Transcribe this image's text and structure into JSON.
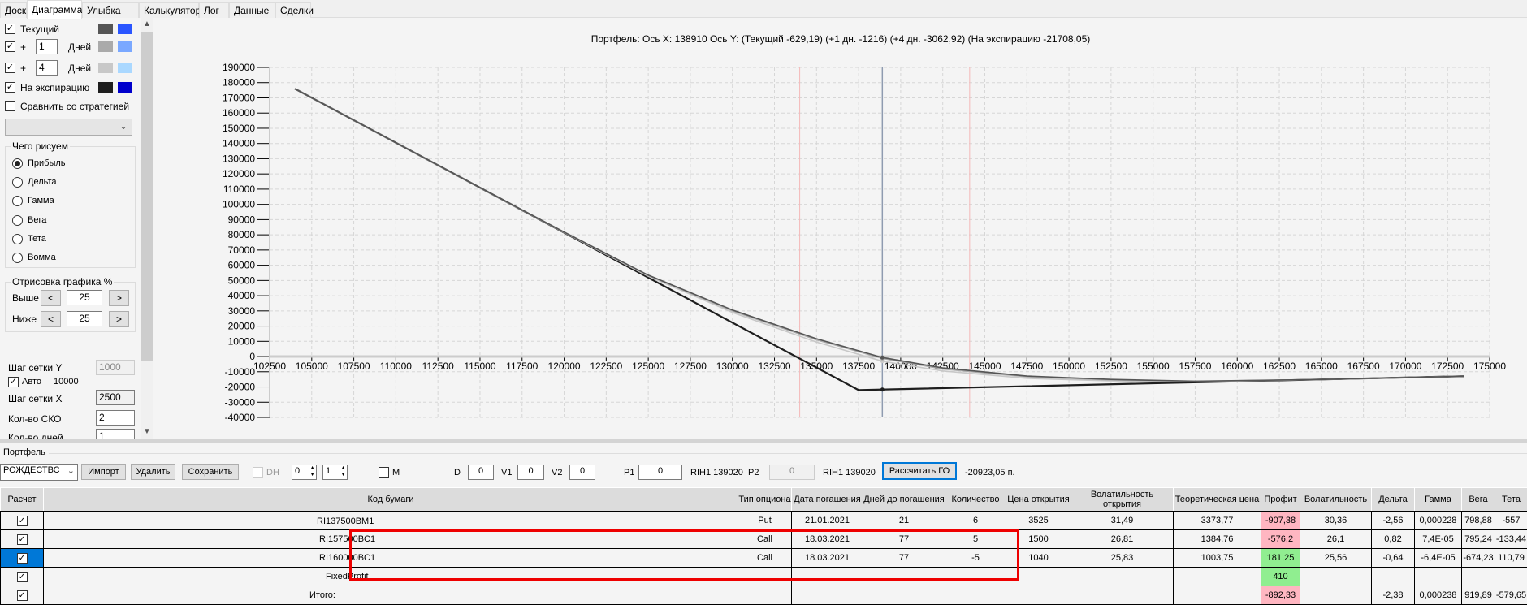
{
  "tabs": [
    {
      "label": "Доска"
    },
    {
      "label": "Диаграмма",
      "active": true
    },
    {
      "label": "Улыбка"
    },
    {
      "label": "Калькулятор"
    },
    {
      "label": "Лог"
    },
    {
      "label": "Данные"
    },
    {
      "label": "Сделки"
    }
  ],
  "left_panel": {
    "series_toggles": [
      {
        "label": "Текущий",
        "checked": true,
        "color1": "#555555",
        "color2": "#2a55ff"
      },
      {
        "prefix": "+",
        "days": "1",
        "suffix": "Дней",
        "checked": true,
        "color1": "#aaaaaa",
        "color2": "#7aa8ff"
      },
      {
        "prefix": "+",
        "days": "4",
        "suffix": "Дней",
        "checked": true,
        "color1": "#c8c8c8",
        "color2": "#aad8ff"
      },
      {
        "label": "На экспирацию",
        "checked": true,
        "color1": "#1e1e1e",
        "color2": "#0000cc"
      }
    ],
    "compare_label": "Сравнить со стратегией",
    "compare_checked": false,
    "compare_select": "",
    "draw_group": {
      "title": "Чего рисуем",
      "options": [
        "Прибыль",
        "Дельта",
        "Гамма",
        "Вега",
        "Тета",
        "Вомма"
      ],
      "selected": "Прибыль"
    },
    "render_group": {
      "title": "Отрисовка графика %",
      "above_label": "Выше",
      "above_value": "25",
      "below_label": "Ниже",
      "below_value": "25",
      "dec": "<",
      "inc": ">"
    },
    "grid_y_label": "Шаг сетки Y",
    "grid_y_value": "1000",
    "auto_label": "Авто",
    "auto_checked": true,
    "auto_value": "10000",
    "grid_x_label": "Шаг сетки X",
    "grid_x_value": "2500",
    "sko_label": "Кол-во СКО",
    "sko_value": "2",
    "days_label": "Кол-во дней",
    "days_value": "1"
  },
  "chart_data": {
    "type": "line",
    "title": "Портфель: Ось X: 138910 Ось Y:  (Текущий -629,19)  (+1 дн. -1216)  (+4 дн. -3062,92)  (На экспирацию -21708,05)",
    "xlim": [
      102500,
      175000
    ],
    "ylim": [
      -40000,
      190000
    ],
    "x_ticks": [
      102500,
      105000,
      107500,
      110000,
      112500,
      115000,
      117500,
      120000,
      122500,
      125000,
      127500,
      130000,
      132500,
      135000,
      137500,
      140000,
      142500,
      145000,
      147500,
      150000,
      152500,
      155000,
      157500,
      160000,
      162500,
      165000,
      167500,
      170000,
      172500,
      175000
    ],
    "y_ticks": [
      190000,
      180000,
      170000,
      160000,
      150000,
      140000,
      130000,
      120000,
      110000,
      100000,
      90000,
      80000,
      70000,
      60000,
      50000,
      40000,
      30000,
      20000,
      10000,
      0,
      -10000,
      -20000,
      -30000,
      -40000
    ],
    "grid": true,
    "cursor_x": 138910,
    "sd_lines": [
      134000,
      144100
    ],
    "series": [
      {
        "name": "На экспирацию",
        "color": "#1e1e1e",
        "points": [
          [
            104000,
            176000
          ],
          [
            137500,
            -22050
          ],
          [
            173500,
            -12900
          ]
        ]
      },
      {
        "name": "+4 дн.",
        "color": "#c8c8c8",
        "points": [
          [
            104000,
            176000
          ],
          [
            110000,
            140500
          ],
          [
            115000,
            110900
          ],
          [
            120000,
            81500
          ],
          [
            125000,
            52800
          ],
          [
            130000,
            29000
          ],
          [
            135000,
            9500
          ],
          [
            138910,
            -3063
          ],
          [
            142500,
            -9500
          ],
          [
            147500,
            -14300
          ],
          [
            152500,
            -16000
          ],
          [
            157500,
            -16600
          ],
          [
            165000,
            -15060
          ],
          [
            173500,
            -12900
          ]
        ]
      },
      {
        "name": "+1 дн.",
        "color": "#aaaaaa",
        "points": [
          [
            104000,
            176000
          ],
          [
            110000,
            140500
          ],
          [
            115000,
            111000
          ],
          [
            120000,
            81700
          ],
          [
            125000,
            53300
          ],
          [
            130000,
            30000
          ],
          [
            135000,
            11000
          ],
          [
            138910,
            -1216
          ],
          [
            142500,
            -8200
          ],
          [
            147500,
            -13300
          ],
          [
            152500,
            -15400
          ],
          [
            157500,
            -16300
          ],
          [
            165000,
            -15060
          ],
          [
            173500,
            -12900
          ]
        ]
      },
      {
        "name": "Текущий",
        "color": "#555555",
        "points": [
          [
            104000,
            176000
          ],
          [
            110000,
            140500
          ],
          [
            115000,
            111000
          ],
          [
            120000,
            81800
          ],
          [
            125000,
            53500
          ],
          [
            130000,
            30600
          ],
          [
            135000,
            11700
          ],
          [
            138910,
            -629
          ],
          [
            142500,
            -7500
          ],
          [
            147500,
            -12800
          ],
          [
            152500,
            -15000
          ],
          [
            157500,
            -16200
          ],
          [
            165000,
            -15060
          ],
          [
            173500,
            -12900
          ]
        ]
      }
    ]
  },
  "portfolio": {
    "title": "Портфель",
    "name_select": "РОЖДЕСТВС",
    "import": "Импорт",
    "delete": "Удалить",
    "save": "Сохранить",
    "dh_label": "DH",
    "spin1": "0",
    "spin2": "1",
    "m_label": "M",
    "d_label": "D",
    "d_value": "0",
    "v1_label": "V1",
    "v1_value": "0",
    "v2_label": "V2",
    "v2_value": "0",
    "p1_label": "P1",
    "p1_value": "0",
    "p1_ref": "RIH1 139020",
    "p2_label": "P2",
    "p2_value": "0",
    "p2_ref": "RIH1 139020",
    "calc_go": "Рассчитать ГО",
    "go_value": "-20923,05 п."
  },
  "table": {
    "headers": [
      "Расчет",
      "Код бумаги",
      "Тип опциона",
      "Дата погашения",
      "Дней до погашения",
      "Количество",
      "Цена открытия",
      "Волатильность открытия",
      "Теоретическая цена",
      "Профит",
      "Волатильность",
      "Дельта",
      "Гамма",
      "Вега",
      "Тета"
    ],
    "rows": [
      {
        "cells": [
          "RI137500BM1",
          "Put",
          "21.01.2021",
          "21",
          "6",
          "3525",
          "31,49",
          "3373,77",
          "-907,38",
          "30,36",
          "-2,56",
          "0,000228",
          "798,88",
          "-557"
        ],
        "profit_state": "neg"
      },
      {
        "cells": [
          "RI157500BC1",
          "Call",
          "18.03.2021",
          "77",
          "5",
          "1500",
          "26,81",
          "1384,76",
          "-576,2",
          "26,1",
          "0,82",
          "7,4E-05",
          "795,24",
          "-133,44"
        ],
        "profit_state": "neg"
      },
      {
        "cells": [
          "RI160000BC1",
          "Call",
          "18.03.2021",
          "77",
          "-5",
          "1040",
          "25,83",
          "1003,75",
          "181,25",
          "25,56",
          "-0,64",
          "-6,4E-05",
          "-674,23",
          "110,79"
        ],
        "profit_state": "pos",
        "selected": true
      },
      {
        "cells": [
          "FixedProfit",
          "",
          "",
          "",
          "",
          "",
          "",
          "",
          "410",
          "",
          "",
          "",
          "",
          ""
        ],
        "profit_state": "pos"
      },
      {
        "cells": [
          "Итого:",
          "",
          "",
          "",
          "",
          "",
          "",
          "",
          "-892,33",
          "",
          "-2,38",
          "0,000238",
          "919,89",
          "-579,65"
        ],
        "profit_state": "neg"
      }
    ]
  }
}
